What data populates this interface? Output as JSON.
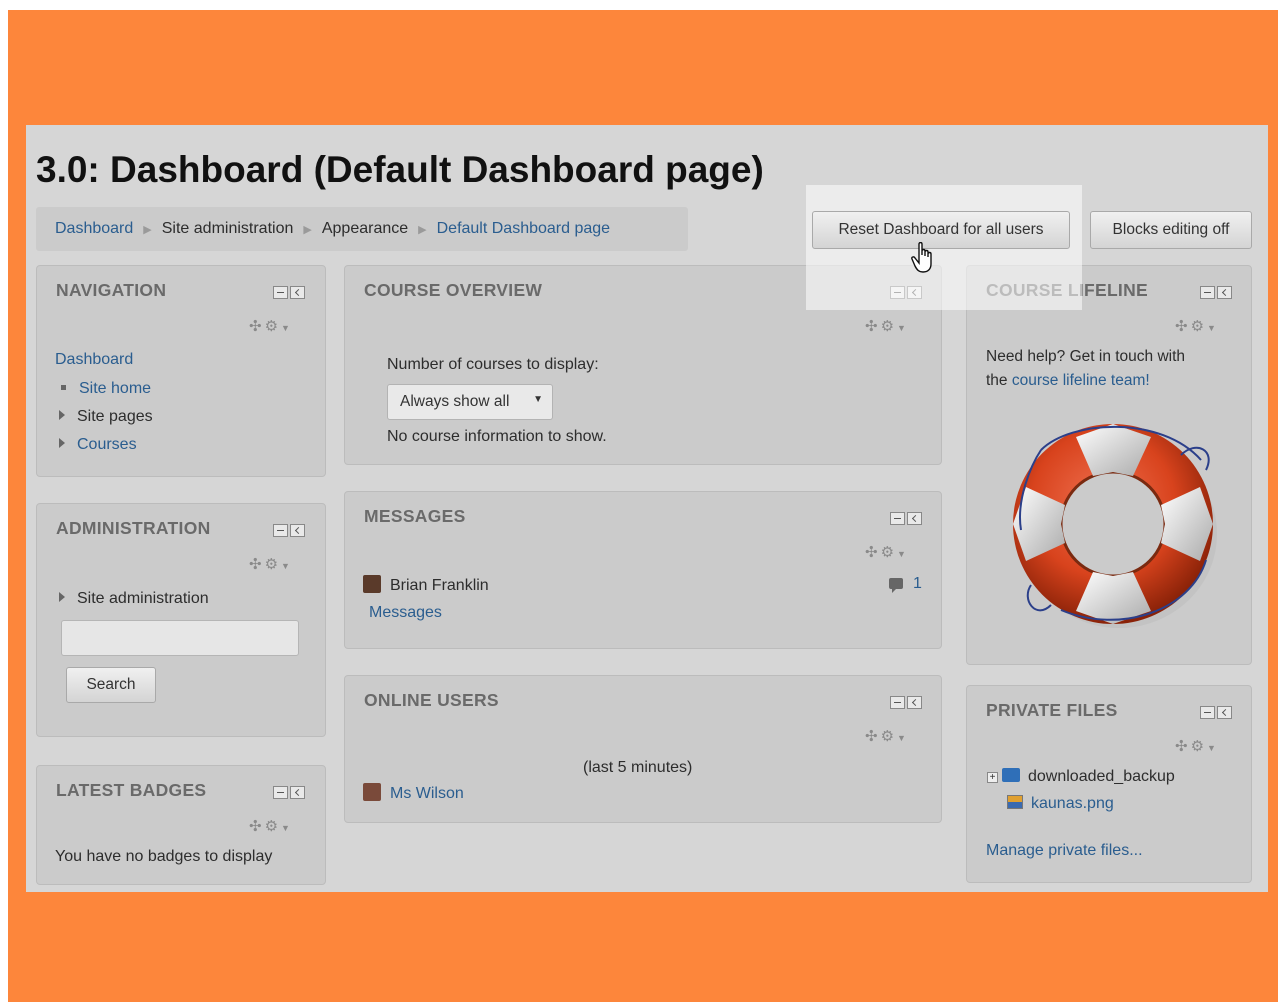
{
  "page_title": "3.0: Dashboard (Default Dashboard page)",
  "breadcrumb": [
    "Dashboard",
    "Site administration",
    "Appearance",
    "Default Dashboard page"
  ],
  "buttons": {
    "reset_dashboard": "Reset Dashboard for all users",
    "blocks_editing": "Blocks editing off"
  },
  "navigation": {
    "title": "NAVIGATION",
    "dashboard": "Dashboard",
    "items": [
      "Site home",
      "Site pages",
      "Courses"
    ]
  },
  "administration": {
    "title": "ADMINISTRATION",
    "site_admin": "Site administration",
    "search_value": "",
    "search_button": "Search"
  },
  "latest_badges": {
    "title": "LATEST BADGES",
    "text": "You have no badges to display"
  },
  "course_overview": {
    "title": "COURSE OVERVIEW",
    "label": "Number of courses to display:",
    "select_value": "Always show all",
    "no_info": "No course information to show."
  },
  "messages": {
    "title": "MESSAGES",
    "sender": "Brian Franklin",
    "count": "1",
    "link": "Messages"
  },
  "online_users": {
    "title": "ONLINE USERS",
    "period": "(last 5 minutes)",
    "user": "Ms Wilson"
  },
  "course_lifeline": {
    "title": "COURSE LIFELINE",
    "text_before": "Need help? Get in touch with",
    "text_the": "the ",
    "link": "course lifeline team!"
  },
  "private_files": {
    "title": "PRIVATE FILES",
    "folder": "downloaded_backup",
    "file": "kaunas.png",
    "manage": "Manage private files..."
  },
  "icons": [
    "move-icon",
    "gear-icon",
    "dock-icon",
    "hide-icon",
    "comment-icon",
    "folder-icon",
    "image-file-icon",
    "hand-cursor-icon"
  ],
  "colors": {
    "frame_orange": "#fd863b",
    "link_blue": "#2a5d8f",
    "block_bg": "#cbcbcb"
  }
}
